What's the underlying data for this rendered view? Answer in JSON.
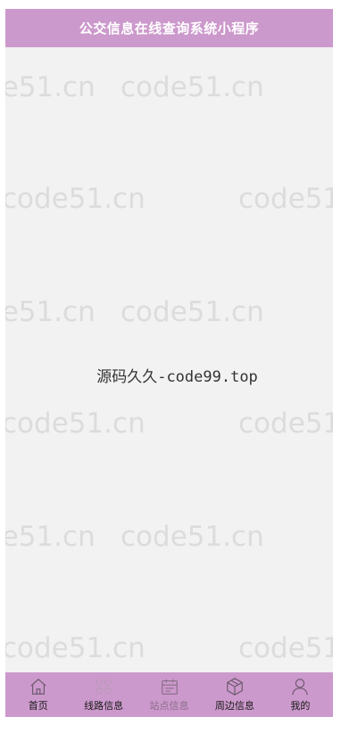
{
  "header": {
    "title": "公交信息在线查询系统小程序"
  },
  "watermark": {
    "text": "code51.cn"
  },
  "main": {
    "center_text": "源码久久-code99.top"
  },
  "tabbar": {
    "items": [
      {
        "label": "首页",
        "icon": "home-icon"
      },
      {
        "label": "线路信息",
        "icon": "grid-icon"
      },
      {
        "label": "站点信息",
        "icon": "calendar-icon",
        "active": true
      },
      {
        "label": "周边信息",
        "icon": "box-icon"
      },
      {
        "label": "我的",
        "icon": "user-icon"
      }
    ],
    "colors": {
      "background": "#cc99cc",
      "active_label": "#8a6f8a"
    }
  },
  "colors": {
    "header_bg": "#cc99cc",
    "page_bg": "#f2f2f2"
  }
}
